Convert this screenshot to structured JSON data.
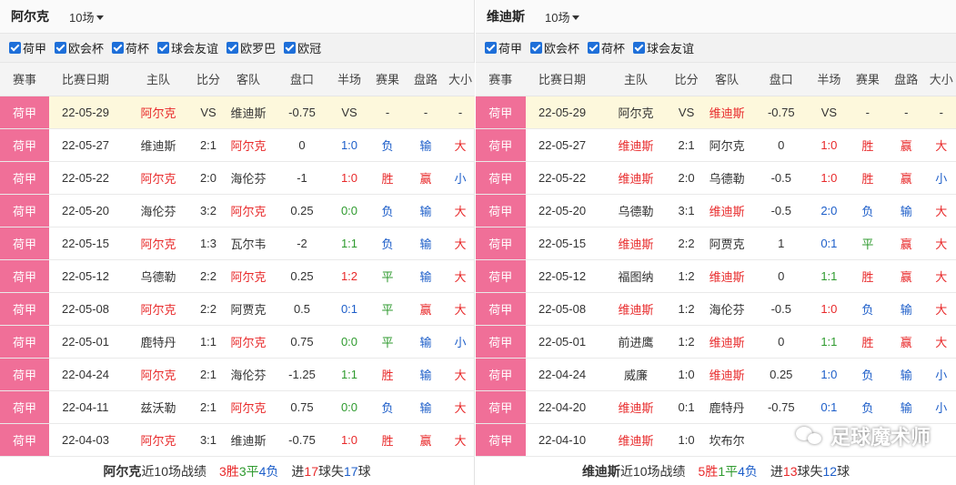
{
  "headers": [
    "赛事",
    "比赛日期",
    "主队",
    "比分",
    "客队",
    "盘口",
    "半场",
    "赛果",
    "盘路",
    "大小"
  ],
  "panels": [
    {
      "team": "阿尔克",
      "games": "10场",
      "filters": [
        "荷甲",
        "欧会杯",
        "荷杯",
        "球会友谊",
        "欧罗巴",
        "欧冠"
      ],
      "rows": [
        {
          "league": "荷甲",
          "date": "22-05-29",
          "home": "阿尔克",
          "score": "VS",
          "away": "维迪斯",
          "handicap": "-0.75",
          "half": "VS",
          "result": "-",
          "hcp_result": "-",
          "ou": "-",
          "home_hl": true,
          "away_hl": false,
          "future": true
        },
        {
          "league": "荷甲",
          "date": "22-05-27",
          "home": "维迪斯",
          "score": "2:1",
          "away": "阿尔克",
          "handicap": "0",
          "half": "1:0",
          "result": "负",
          "hcp_result": "输",
          "ou": "大",
          "home_hl": false,
          "away_hl": true
        },
        {
          "league": "荷甲",
          "date": "22-05-22",
          "home": "阿尔克",
          "score": "2:0",
          "away": "海伦芬",
          "handicap": "-1",
          "half": "1:0",
          "result": "胜",
          "hcp_result": "赢",
          "ou": "小",
          "home_hl": true,
          "away_hl": false
        },
        {
          "league": "荷甲",
          "date": "22-05-20",
          "home": "海伦芬",
          "score": "3:2",
          "away": "阿尔克",
          "handicap": "0.25",
          "half": "0:0",
          "result": "负",
          "hcp_result": "输",
          "ou": "大",
          "home_hl": false,
          "away_hl": true
        },
        {
          "league": "荷甲",
          "date": "22-05-15",
          "home": "阿尔克",
          "score": "1:3",
          "away": "瓦尔韦",
          "handicap": "-2",
          "half": "1:1",
          "result": "负",
          "hcp_result": "输",
          "ou": "大",
          "home_hl": true,
          "away_hl": false
        },
        {
          "league": "荷甲",
          "date": "22-05-12",
          "home": "乌德勒",
          "score": "2:2",
          "away": "阿尔克",
          "handicap": "0.25",
          "half": "1:2",
          "result": "平",
          "hcp_result": "输",
          "ou": "大",
          "home_hl": false,
          "away_hl": true
        },
        {
          "league": "荷甲",
          "date": "22-05-08",
          "home": "阿尔克",
          "score": "2:2",
          "away": "阿贾克",
          "handicap": "0.5",
          "half": "0:1",
          "result": "平",
          "hcp_result": "赢",
          "ou": "大",
          "home_hl": true,
          "away_hl": false
        },
        {
          "league": "荷甲",
          "date": "22-05-01",
          "home": "鹿特丹",
          "score": "1:1",
          "away": "阿尔克",
          "handicap": "0.75",
          "half": "0:0",
          "result": "平",
          "hcp_result": "输",
          "ou": "小",
          "home_hl": false,
          "away_hl": true
        },
        {
          "league": "荷甲",
          "date": "22-04-24",
          "home": "阿尔克",
          "score": "2:1",
          "away": "海伦芬",
          "handicap": "-1.25",
          "half": "1:1",
          "result": "胜",
          "hcp_result": "输",
          "ou": "大",
          "home_hl": true,
          "away_hl": false
        },
        {
          "league": "荷甲",
          "date": "22-04-11",
          "home": "兹沃勒",
          "score": "2:1",
          "away": "阿尔克",
          "handicap": "0.75",
          "half": "0:0",
          "result": "负",
          "hcp_result": "输",
          "ou": "大",
          "home_hl": false,
          "away_hl": true
        },
        {
          "league": "荷甲",
          "date": "22-04-03",
          "home": "阿尔克",
          "score": "3:1",
          "away": "维迪斯",
          "handicap": "-0.75",
          "half": "1:0",
          "result": "胜",
          "hcp_result": "赢",
          "ou": "大",
          "home_hl": true,
          "away_hl": false
        }
      ],
      "summary": {
        "name": "阿尔克",
        "label": "近10场战绩",
        "wins": "3胜",
        "draws": "3平",
        "losses": "4负",
        "p1": "进",
        "goals_for": "17",
        "p2": "球失",
        "goals_against": "17",
        "p3": "球"
      }
    },
    {
      "team": "维迪斯",
      "games": "10场",
      "filters": [
        "荷甲",
        "欧会杯",
        "荷杯",
        "球会友谊"
      ],
      "rows": [
        {
          "league": "荷甲",
          "date": "22-05-29",
          "home": "阿尔克",
          "score": "VS",
          "away": "维迪斯",
          "handicap": "-0.75",
          "half": "VS",
          "result": "-",
          "hcp_result": "-",
          "ou": "-",
          "home_hl": false,
          "away_hl": true,
          "future": true
        },
        {
          "league": "荷甲",
          "date": "22-05-27",
          "home": "维迪斯",
          "score": "2:1",
          "away": "阿尔克",
          "handicap": "0",
          "half": "1:0",
          "result": "胜",
          "hcp_result": "赢",
          "ou": "大",
          "home_hl": true,
          "away_hl": false
        },
        {
          "league": "荷甲",
          "date": "22-05-22",
          "home": "维迪斯",
          "score": "2:0",
          "away": "乌德勒",
          "handicap": "-0.5",
          "half": "1:0",
          "result": "胜",
          "hcp_result": "赢",
          "ou": "小",
          "home_hl": true,
          "away_hl": false
        },
        {
          "league": "荷甲",
          "date": "22-05-20",
          "home": "乌德勒",
          "score": "3:1",
          "away": "维迪斯",
          "handicap": "-0.5",
          "half": "2:0",
          "result": "负",
          "hcp_result": "输",
          "ou": "大",
          "home_hl": false,
          "away_hl": true
        },
        {
          "league": "荷甲",
          "date": "22-05-15",
          "home": "维迪斯",
          "score": "2:2",
          "away": "阿贾克",
          "handicap": "1",
          "half": "0:1",
          "result": "平",
          "hcp_result": "赢",
          "ou": "大",
          "home_hl": true,
          "away_hl": false
        },
        {
          "league": "荷甲",
          "date": "22-05-12",
          "home": "福图纳",
          "score": "1:2",
          "away": "维迪斯",
          "handicap": "0",
          "half": "1:1",
          "result": "胜",
          "hcp_result": "赢",
          "ou": "大",
          "home_hl": false,
          "away_hl": true
        },
        {
          "league": "荷甲",
          "date": "22-05-08",
          "home": "维迪斯",
          "score": "1:2",
          "away": "海伦芬",
          "handicap": "-0.5",
          "half": "1:0",
          "result": "负",
          "hcp_result": "输",
          "ou": "大",
          "home_hl": true,
          "away_hl": false
        },
        {
          "league": "荷甲",
          "date": "22-05-01",
          "home": "前进鹰",
          "score": "1:2",
          "away": "维迪斯",
          "handicap": "0",
          "half": "1:1",
          "result": "胜",
          "hcp_result": "赢",
          "ou": "大",
          "home_hl": false,
          "away_hl": true
        },
        {
          "league": "荷甲",
          "date": "22-04-24",
          "home": "威廉",
          "score": "1:0",
          "away": "维迪斯",
          "handicap": "0.25",
          "half": "1:0",
          "result": "负",
          "hcp_result": "输",
          "ou": "小",
          "home_hl": false,
          "away_hl": true
        },
        {
          "league": "荷甲",
          "date": "22-04-20",
          "home": "维迪斯",
          "score": "0:1",
          "away": "鹿特丹",
          "handicap": "-0.75",
          "half": "0:1",
          "result": "负",
          "hcp_result": "输",
          "ou": "小",
          "home_hl": true,
          "away_hl": false
        },
        {
          "league": "荷甲",
          "date": "22-04-10",
          "home": "维迪斯",
          "score": "1:0",
          "away": "坎布尔",
          "handicap": "",
          "half": "",
          "result": "",
          "hcp_result": "",
          "ou": "",
          "home_hl": true,
          "away_hl": false
        }
      ],
      "summary": {
        "name": "维迪斯",
        "label": "近10场战绩",
        "wins": "5胜",
        "draws": "1平",
        "losses": "4负",
        "p1": "进",
        "goals_for": "13",
        "p2": "球失",
        "goals_against": "12",
        "p3": "球"
      }
    }
  ],
  "watermark": {
    "text": "足球魔术师",
    "icon": "wechat-icon"
  },
  "colors": {
    "league_bg": "#f06f98",
    "future_row_bg": "#fdf8dc",
    "red": "#e8292a",
    "green": "#2e9a2e",
    "blue": "#1d5ec9",
    "checkbox": "#1e6fd9"
  }
}
